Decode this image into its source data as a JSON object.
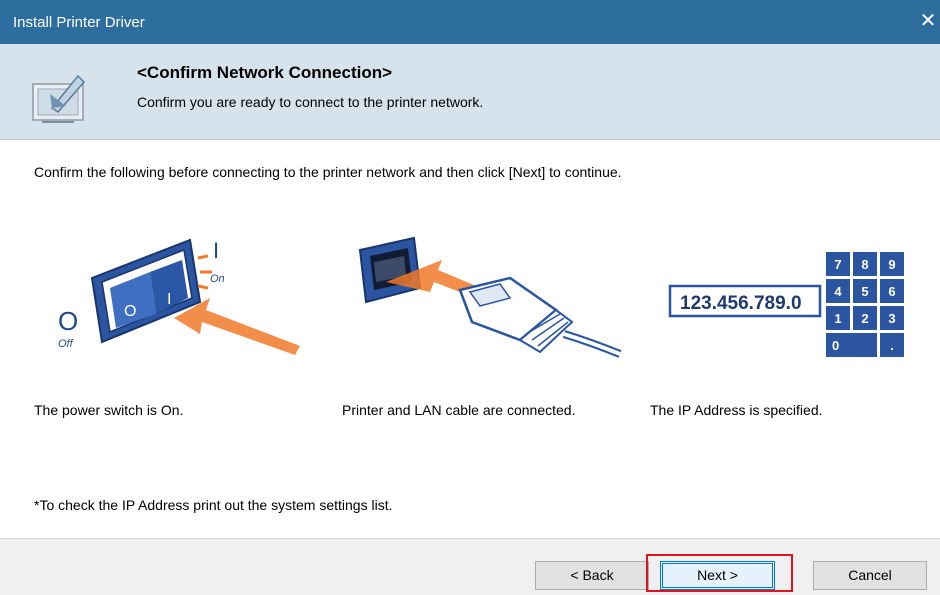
{
  "window": {
    "title": "Install Printer Driver",
    "close_glyph": "✕"
  },
  "header": {
    "icon": "install-monitor-icon",
    "title": "<Confirm Network Connection>",
    "subtitle": "Confirm you are ready to connect to the printer network."
  },
  "content": {
    "instruction": "Confirm the following before connecting to the printer network and then click [Next] to continue.",
    "items": [
      {
        "icon": "power-switch-icon",
        "caption": "The power switch is On.",
        "switch_labels": {
          "off": "Off",
          "on": "On",
          "off_symbol": "O",
          "on_symbol": "I"
        }
      },
      {
        "icon": "lan-cable-icon",
        "caption": "Printer and LAN cable are connected."
      },
      {
        "icon": "ip-keypad-icon",
        "caption": "The IP Address is specified.",
        "ip_example": "123.456.789.0",
        "keys": [
          "7",
          "8",
          "9",
          "4",
          "5",
          "6",
          "1",
          "2",
          "3",
          "0",
          "."
        ]
      }
    ],
    "note": "*To check the IP Address print out the system settings list."
  },
  "buttons": {
    "back": "< Back",
    "next": "Next >",
    "cancel": "Cancel"
  },
  "colors": {
    "titlebar": "#2d6e9f",
    "header_bg": "#d6e3ed",
    "accent_blue": "#1f4a8a",
    "arrow_orange": "#f07a2a",
    "highlight_red": "#e0141e"
  }
}
